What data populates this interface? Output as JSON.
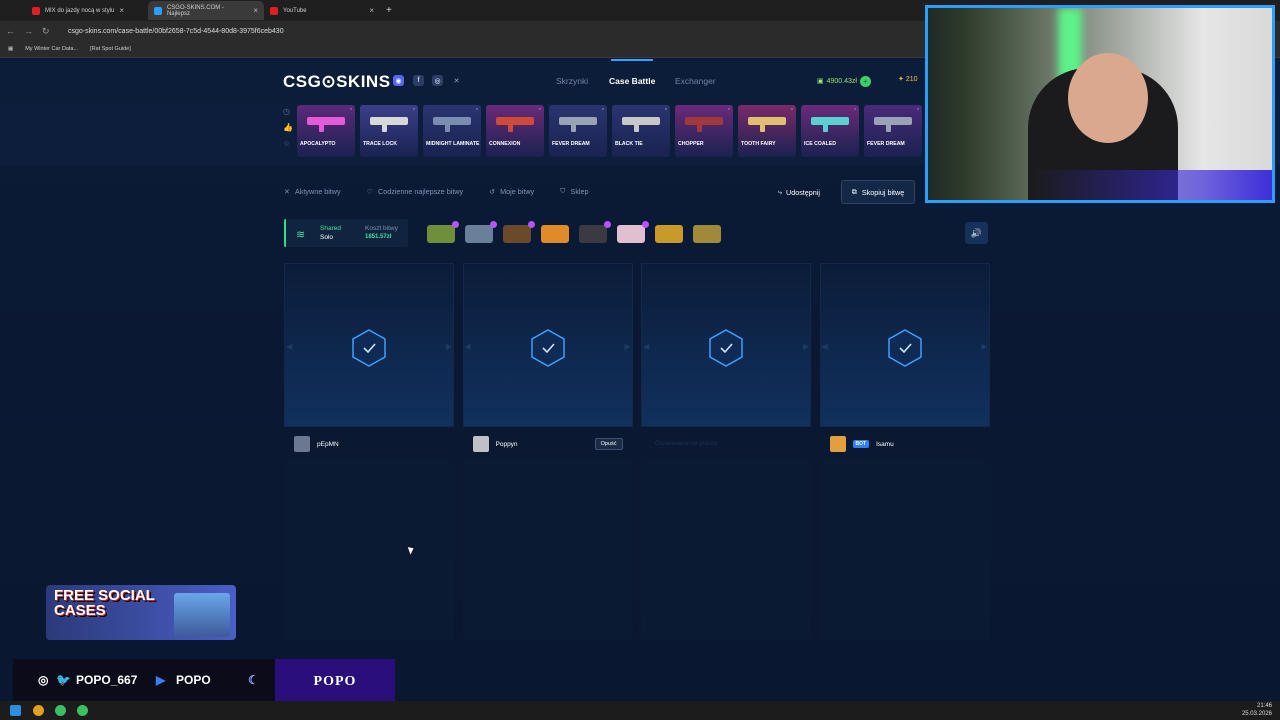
{
  "browser": {
    "tabs": [
      {
        "title": "MIX do jazdy nocą w stylu",
        "color": "#e02020"
      },
      {
        "title": "CSGO-SKINS.COM - Najlepsz",
        "color": "#2a9fff"
      },
      {
        "title": "YouTube",
        "color": "#e02020"
      }
    ],
    "url": "csgo-skins.com/case-battle/00bf2658-7c5d-4544-80d8-3975f6ceb430",
    "bookmarks": [
      "My Winter Car Data...",
      "[Rat Spot Guide]"
    ]
  },
  "site": {
    "logo": "CSG⊙SKINS",
    "nav": [
      "Skrzynki",
      "Case Battle",
      "Exchanger"
    ],
    "active_nav": "Case Battle",
    "balance": "4900.43zł",
    "coins": "210"
  },
  "live_drops": [
    {
      "name": "APOCALYPTO",
      "color": "#5b2a7a",
      "gun": "#e45ad8"
    },
    {
      "name": "TRACE LOCK",
      "color": "#3b3f8a",
      "gun": "#d8d8d8"
    },
    {
      "name": "MIDNIGHT LAMINATE",
      "color": "#2a3570",
      "gun": "#7a8db0"
    },
    {
      "name": "CONNEXION",
      "color": "#6a2a7a",
      "gun": "#d04a3a"
    },
    {
      "name": "FEVER DREAM",
      "color": "#2a3570",
      "gun": "#9aa3b5"
    },
    {
      "name": "BLACK TIE",
      "color": "#2a3570",
      "gun": "#c8c8c8"
    },
    {
      "name": "CHOPPER",
      "color": "#6a2a7a",
      "gun": "#a03a3a"
    },
    {
      "name": "TOOTH FAIRY",
      "color": "#7a2a6a",
      "gun": "#e0c070"
    },
    {
      "name": "ICE COALED",
      "color": "#6a2a7a",
      "gun": "#5ad0d0"
    },
    {
      "name": "FEVER DREAM",
      "color": "#4a2a7a",
      "gun": "#9aa3b5"
    }
  ],
  "subnav": {
    "items": [
      "Aktywne bitwy",
      "Codzienne najlepsze bitwy",
      "Moje bitwy",
      "Sklep"
    ],
    "share": "Udostępnij",
    "copy": "Skopiuj bitwę"
  },
  "battle": {
    "mode_type": "Shared",
    "mode_sub": "Solo",
    "cost_label": "Koszt bitwy",
    "cost_value": "1851.57zł",
    "cases": [
      {
        "color": "#6f8f3a",
        "badge": true
      },
      {
        "color": "#6a7f9a",
        "badge": true
      },
      {
        "color": "#6a4a2a",
        "badge": true
      },
      {
        "color": "#e08a2a",
        "badge": false
      },
      {
        "color": "#3a3a40",
        "badge": true
      },
      {
        "color": "#e0c0d0",
        "badge": true
      },
      {
        "color": "#c89a2a",
        "badge": false
      },
      {
        "color": "#a08a3a",
        "badge": false
      }
    ],
    "players": [
      {
        "name": "pEpMN",
        "bot": false,
        "leave": ""
      },
      {
        "name": "Poppyn",
        "bot": false,
        "leave": "Opuść"
      },
      {
        "name": "Oczekiwanie na gracza",
        "bot": false,
        "leave": "",
        "waiting": true
      },
      {
        "name": "Isamu",
        "bot": true,
        "bot_label": "BOT",
        "leave": ""
      }
    ]
  },
  "overlay": {
    "promo": "FREE SOCIAL CASES",
    "twitter": "POPO_667",
    "youtube": "POPO",
    "brand": "POPO"
  },
  "taskbar": {
    "time": "21:46",
    "date": "25.03.2026"
  }
}
